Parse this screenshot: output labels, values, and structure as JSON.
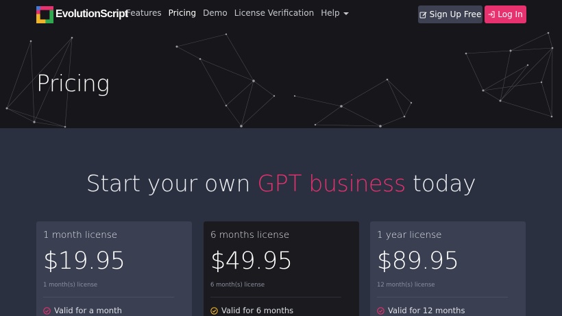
{
  "brand": {
    "name": "EvolutionScript",
    "icon": "evolutionscript-logo-icon"
  },
  "nav": {
    "items": [
      {
        "label": "Features"
      },
      {
        "label": "Pricing"
      },
      {
        "label": "Demo"
      },
      {
        "label": "License Verification"
      },
      {
        "label": "Help"
      }
    ],
    "active": "Pricing"
  },
  "actions": {
    "signup": {
      "label": "Sign Up Free",
      "icon": "edit-icon"
    },
    "login": {
      "label": "Log In",
      "icon": "login-icon"
    }
  },
  "hero": {
    "title": "Pricing"
  },
  "section": {
    "title_before": "Start your own ",
    "title_accent": "GPT business",
    "title_after": " today"
  },
  "plans": [
    {
      "name": "1 month license",
      "price": "$19.95",
      "subtitle": "1 month(s) license",
      "feature": "Valid for a month"
    },
    {
      "name": "6 months license",
      "price": "$49.95",
      "subtitle": "6 month(s) license",
      "feature": "Valid for 6 months"
    },
    {
      "name": "1 year license",
      "price": "$89.95",
      "subtitle": "12 month(s) license",
      "feature": "Valid for 12 months"
    }
  ],
  "colors": {
    "accent": "#e8316f",
    "check_pink": "#e8316f",
    "check_yellow": "#f0b429",
    "hero_bg": "#17171b",
    "page_bg": "#2b3041",
    "card_bg": "#3a3f52",
    "card_featured_bg": "#1b1b1f"
  }
}
